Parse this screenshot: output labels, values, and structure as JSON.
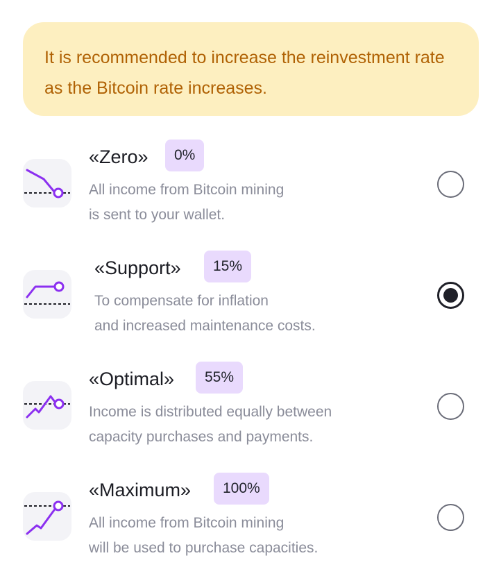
{
  "notice": {
    "text": "It is recommended to increase the reinvestment rate as the Bitcoin rate increases."
  },
  "options": [
    {
      "title": "«Zero»",
      "rate": "0%",
      "desc_line1": "All income from Bitcoin mining",
      "desc_line2": "is sent to your wallet.",
      "icon": "trend-down-icon",
      "selected": false
    },
    {
      "title": "«Support»",
      "rate": "15%",
      "desc_line1": "To compensate for inflation",
      "desc_line2": "and increased maintenance costs.",
      "icon": "trend-flat-up-icon",
      "selected": true
    },
    {
      "title": "«Optimal»",
      "rate": "55%",
      "desc_line1": "Income is distributed equally between",
      "desc_line2": "capacity purchases and payments.",
      "icon": "trend-zigzag-icon",
      "selected": false
    },
    {
      "title": "«Maximum»",
      "rate": "100%",
      "desc_line1": "All income from Bitcoin mining",
      "desc_line2": "will be used to purchase capacities.",
      "icon": "trend-up-icon",
      "selected": false
    }
  ],
  "colors": {
    "notice_bg": "#fdefc0",
    "notice_text": "#b06205",
    "accent": "#8b2ff0",
    "badge_bg": "#e9dafd"
  }
}
